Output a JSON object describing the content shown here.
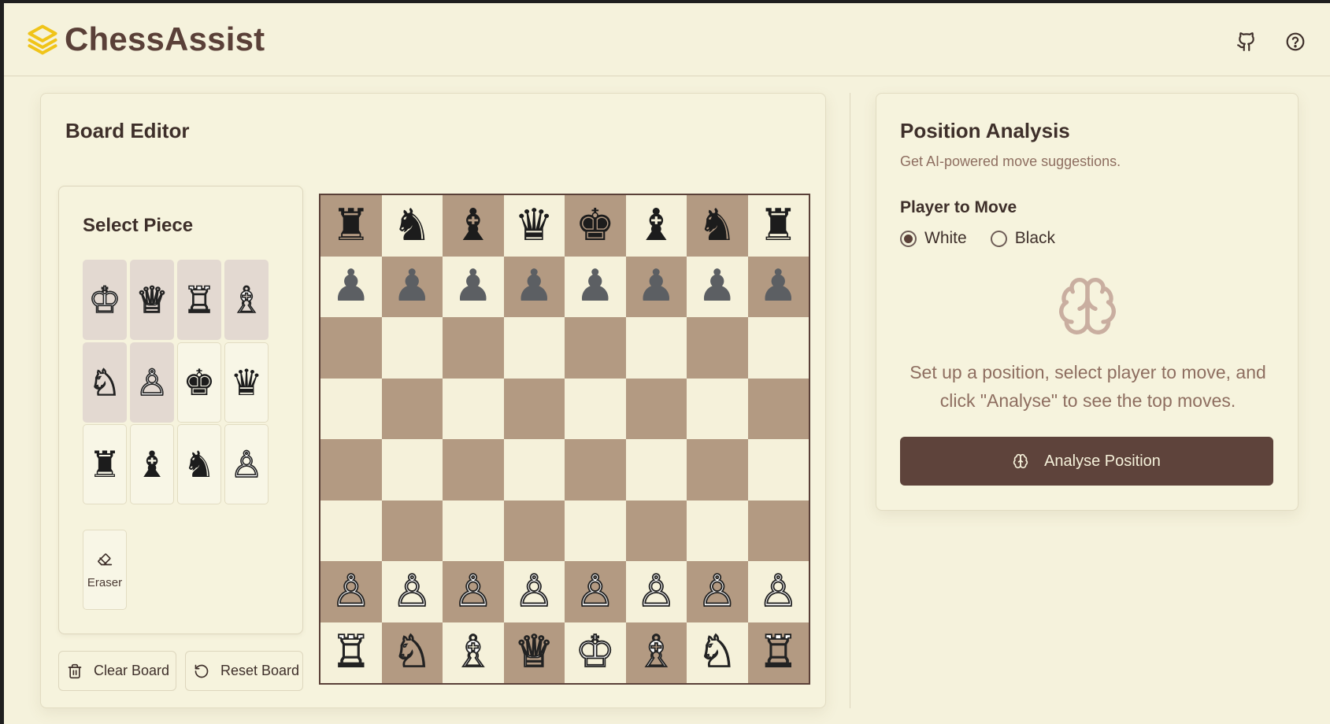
{
  "app": {
    "title": "ChessAssist"
  },
  "header": {
    "github_icon": "github-icon",
    "help_icon": "help-circle-icon"
  },
  "editor": {
    "title": "Board Editor",
    "select_title": "Select Piece",
    "palette": [
      {
        "glyph": "♔",
        "color": "w",
        "selected": true,
        "name": "white-king"
      },
      {
        "glyph": "♕",
        "color": "w",
        "selected": true,
        "name": "white-queen"
      },
      {
        "glyph": "♖",
        "color": "w",
        "selected": true,
        "name": "white-rook"
      },
      {
        "glyph": "♗",
        "color": "w",
        "selected": true,
        "name": "white-bishop"
      },
      {
        "glyph": "♘",
        "color": "w",
        "selected": true,
        "name": "white-knight"
      },
      {
        "glyph": "♙",
        "color": "w",
        "selected": true,
        "name": "white-pawn"
      },
      {
        "glyph": "♚",
        "color": "b",
        "selected": false,
        "name": "black-king"
      },
      {
        "glyph": "♛",
        "color": "b",
        "selected": false,
        "name": "black-queen"
      },
      {
        "glyph": "♜",
        "color": "b",
        "selected": false,
        "name": "black-rook"
      },
      {
        "glyph": "♝",
        "color": "b",
        "selected": false,
        "name": "black-bishop"
      },
      {
        "glyph": "♞",
        "color": "b",
        "selected": false,
        "name": "black-knight"
      },
      {
        "glyph": "♙",
        "color": "w",
        "selected": false,
        "name": "white-pawn-alt"
      }
    ],
    "eraser_label": "Eraser",
    "clear_label": "Clear Board",
    "reset_label": "Reset Board"
  },
  "board": {
    "light_color": "#f5f1da",
    "dark_color": "#b39a82",
    "ranks": [
      [
        "♜",
        "♞",
        "♝",
        "♛",
        "♚",
        "♝",
        "♞",
        "♜"
      ],
      [
        "p",
        "p",
        "p",
        "p",
        "p",
        "p",
        "p",
        "p"
      ],
      [
        "",
        "",
        "",
        "",
        "",
        "",
        "",
        ""
      ],
      [
        "",
        "",
        "",
        "",
        "",
        "",
        "",
        ""
      ],
      [
        "",
        "",
        "",
        "",
        "",
        "",
        "",
        ""
      ],
      [
        "",
        "",
        "",
        "",
        "",
        "",
        "",
        ""
      ],
      [
        "♙",
        "♙",
        "♙",
        "♙",
        "♙",
        "♙",
        "♙",
        "♙"
      ],
      [
        "♖",
        "♘",
        "♗",
        "♕",
        "♔",
        "♗",
        "♘",
        "♖"
      ]
    ]
  },
  "analysis": {
    "title": "Position Analysis",
    "subtitle": "Get AI-powered move suggestions.",
    "player_label": "Player to Move",
    "options": [
      "White",
      "Black"
    ],
    "selected": "White",
    "icon": "brain-icon",
    "message": "Set up a position, select player to move, and click \"Analyse\" to see the top moves.",
    "button_label": "Analyse Position"
  }
}
